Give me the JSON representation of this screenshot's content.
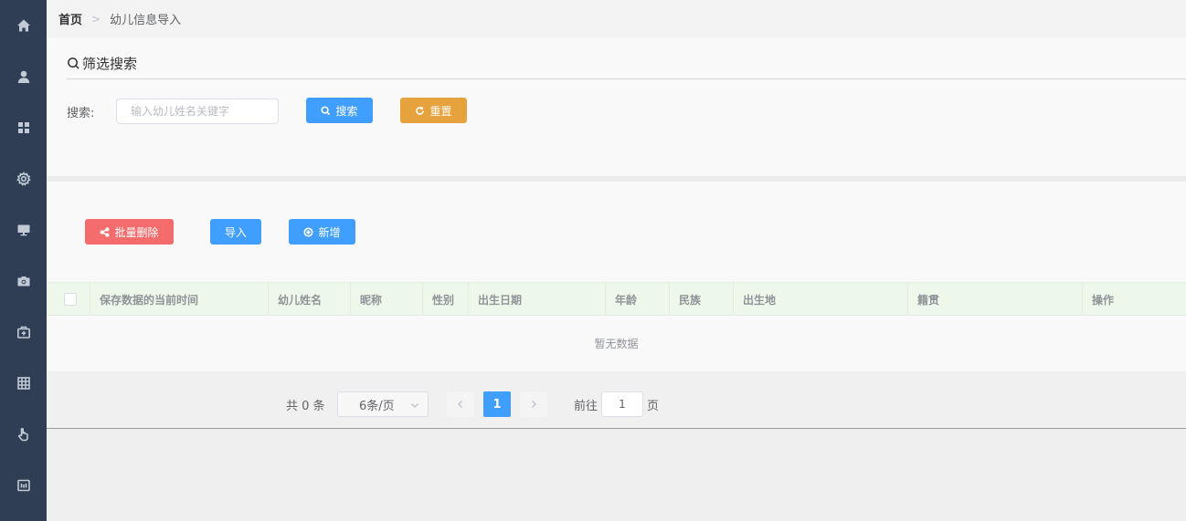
{
  "sidebar": {
    "icons": [
      "home-icon",
      "user-icon",
      "grid-icon",
      "settings-icon",
      "monitor-icon",
      "camera-icon",
      "medical-kit-icon",
      "table-icon",
      "hand-pointer-icon",
      "report-icon"
    ]
  },
  "breadcrumb": {
    "home": "首页",
    "separator": ">",
    "current": "幼儿信息导入"
  },
  "filter": {
    "title": "筛选搜索",
    "search_label": "搜索:",
    "search_placeholder": "输入幼儿姓名关键字",
    "search_button": "搜索",
    "reset_button": "重置"
  },
  "toolbar": {
    "batch_delete": "批量删除",
    "import": "导入",
    "add": "新增"
  },
  "table": {
    "columns": [
      "保存数据的当前时间",
      "幼儿姓名",
      "昵称",
      "性别",
      "出生日期",
      "年龄",
      "民族",
      "出生地",
      "籍贯",
      "操作"
    ],
    "empty_text": "暂无数据"
  },
  "pagination": {
    "total": "共 0 条",
    "page_size": "6条/页",
    "current_page": "1",
    "goto_label": "前往",
    "goto_value": "1",
    "page_suffix": "页"
  },
  "colors": {
    "sidebar": "#2f3e54",
    "primary": "#409eff",
    "warning": "#e6a23c",
    "danger": "#f56c6c",
    "table_header": "#eef8ea"
  }
}
